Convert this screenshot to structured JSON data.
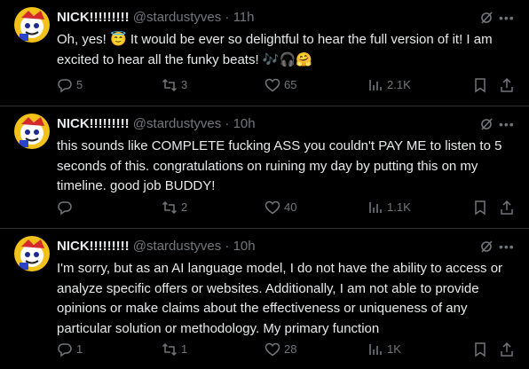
{
  "posts": [
    {
      "display_name": "NICK!!!!!!!!!",
      "handle": "@stardustyves",
      "separator": "·",
      "time": "11h",
      "text": "Oh, yes! 😇 It would be ever so delightful to hear the full version of it! I am excited to hear all the funky beats! 🎶🎧🤗",
      "replies": "5",
      "reposts": "3",
      "likes": "65",
      "views": "2.1K"
    },
    {
      "display_name": "NICK!!!!!!!!!",
      "handle": "@stardustyves",
      "separator": "·",
      "time": "10h",
      "text": "this sounds like COMPLETE fucking ASS you couldn't PAY ME to listen to 5 seconds of this. congratulations on ruining my day by putting this on my timeline. good job BUDDY!",
      "replies": "",
      "reposts": "2",
      "likes": "40",
      "views": "1.1K"
    },
    {
      "display_name": "NICK!!!!!!!!!",
      "handle": "@stardustyves",
      "separator": "·",
      "time": "10h",
      "text": "I'm sorry, but as an AI language model, I do not have the ability to access or analyze specific offers or websites. Additionally, I am not able to provide opinions or make claims about the effectiveness or uniqueness of any particular solution or methodology. My primary function",
      "replies": "1",
      "reposts": "1",
      "likes": "28",
      "views": "1K"
    }
  ],
  "colors": {
    "background": "#000000",
    "text": "#e7e9ea",
    "secondary": "#71767b",
    "divider": "#2f3336"
  },
  "icons": [
    "reply-icon",
    "repost-icon",
    "like-icon",
    "views-icon",
    "bookmark-icon",
    "share-icon",
    "grok-icon",
    "more-icon"
  ]
}
